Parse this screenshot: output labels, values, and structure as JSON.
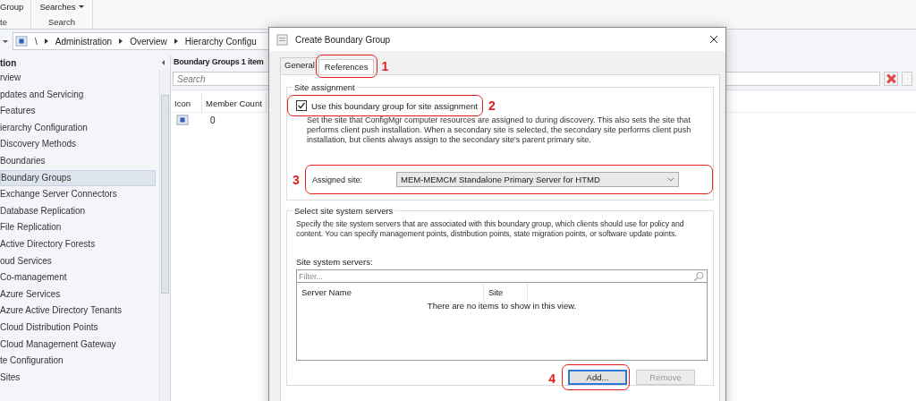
{
  "ribbon": {
    "groups": [
      {
        "button": "Group",
        "label": "te",
        "dropdown": false
      },
      {
        "button": "Searches",
        "label": "Search",
        "dropdown": true
      }
    ]
  },
  "breadcrumb": [
    "\\",
    "Administration",
    "Overview",
    "Hierarchy Configu"
  ],
  "navigation": {
    "header": "tion",
    "items": [
      {
        "label": "rview",
        "selected": false
      },
      {
        "label": "pdates and Servicing",
        "selected": false
      },
      {
        "label": "Features",
        "selected": false
      },
      {
        "label": "ierarchy Configuration",
        "selected": false
      },
      {
        "label": "Discovery Methods",
        "selected": false
      },
      {
        "label": "Boundaries",
        "selected": false
      },
      {
        "label": "Boundary Groups",
        "selected": true
      },
      {
        "label": "Exchange Server Connectors",
        "selected": false
      },
      {
        "label": "Database Replication",
        "selected": false
      },
      {
        "label": "File Replication",
        "selected": false
      },
      {
        "label": "Active Directory Forests",
        "selected": false
      },
      {
        "label": "oud Services",
        "selected": false
      },
      {
        "label": "Co-management",
        "selected": false
      },
      {
        "label": "Azure Services",
        "selected": false
      },
      {
        "label": "Azure Active Directory Tenants",
        "selected": false
      },
      {
        "label": "Cloud Distribution Points",
        "selected": false
      },
      {
        "label": "Cloud Management Gateway",
        "selected": false
      },
      {
        "label": "te Configuration",
        "selected": false
      },
      {
        "label": "Sites",
        "selected": false
      }
    ]
  },
  "list_pane": {
    "title": "Boundary Groups 1 item",
    "search": {
      "placeholder": "Search"
    },
    "columns": [
      "Icon",
      "Member Count"
    ],
    "rows": [
      {
        "member_count": "0"
      }
    ]
  },
  "dialog": {
    "title": "Create Boundary Group",
    "tabs": [
      {
        "label": "General",
        "selected": false
      },
      {
        "label": "References",
        "selected": true
      }
    ],
    "site_assignment": {
      "legend": "Site assignment",
      "checkbox": {
        "label": "Use this boundary group for site assignment",
        "checked": true
      },
      "description": "Set the site that ConfigMgr computer resources are assigned to during discovery. This also sets the site that performs client push installation. When a secondary site is selected, the secondary site performs client push installation, but clients always assign to the secondary site's parent primary site.",
      "assigned_site": {
        "label": "Assigned site:",
        "value": "MEM-MEMCM Standalone Primary Server for HTMD"
      }
    },
    "site_system_servers": {
      "legend": "Select site system servers",
      "description": "Specify the site system servers that are associated with this boundary group, which clients should use for policy and content. You can specify management points, distribution points, state migration points, or software update points.",
      "list_label": "Site system servers:",
      "filter": {
        "placeholder": "Filter..."
      },
      "columns": [
        "Server Name",
        "Site"
      ],
      "empty_message": "There are no items to show in this view.",
      "buttons": [
        {
          "label": "Add...",
          "disabled": false
        },
        {
          "label": "Remove",
          "disabled": true
        }
      ]
    }
  },
  "annotations": [
    {
      "label": "1"
    },
    {
      "label": "2"
    },
    {
      "label": "3"
    },
    {
      "label": "4"
    }
  ]
}
